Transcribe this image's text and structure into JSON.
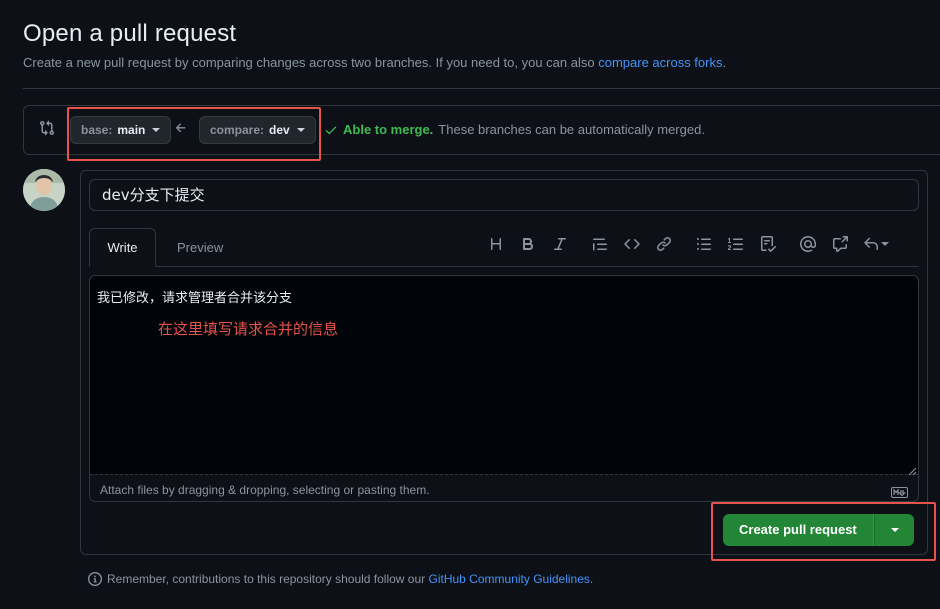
{
  "header": {
    "title": "Open a pull request",
    "subtitle": "Create a new pull request by comparing changes across two branches. If you need to, you can also ",
    "subtitle_link": "compare across forks",
    "subtitle_end": "."
  },
  "range": {
    "base_label": "base:",
    "base_value": "main",
    "compare_label": "compare:",
    "compare_value": "dev",
    "merge_ok": "Able to merge.",
    "merge_text": "These branches can be automatically merged."
  },
  "form": {
    "title_value": "dev分支下提交",
    "tabs": [
      {
        "label": "Write"
      },
      {
        "label": "Preview"
      }
    ],
    "body_value": "我已修改，请求管理者合并该分支",
    "annotation": "在这里填写请求合并的信息",
    "attach_text": "Attach files by dragging & dropping, selecting or pasting them.",
    "toolbar_icons": [
      "heading-icon",
      "bold-icon",
      "italic-icon",
      "quote-icon",
      "code-icon",
      "link-icon",
      "bulleted-list-icon",
      "numbered-list-icon",
      "task-list-icon",
      "mention-icon",
      "cross-reference-icon",
      "saved-reply-icon"
    ]
  },
  "actions": {
    "create_label": "Create pull request"
  },
  "footer": {
    "text": "Remember, contributions to this repository should follow our ",
    "link": "GitHub Community Guidelines",
    "end": "."
  },
  "colors": {
    "background": "#0d1117",
    "accent_green": "#238636",
    "link_blue": "#4493f8",
    "annotation_red": "#e5534b",
    "merge_green": "#3fb950"
  }
}
